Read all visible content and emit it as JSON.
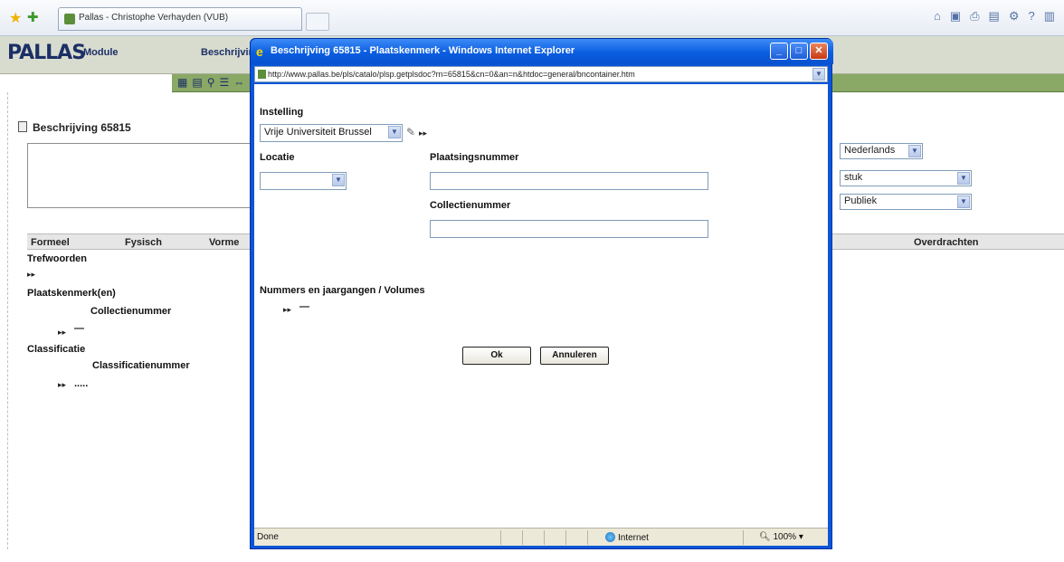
{
  "browser": {
    "tab_title": "Pallas - Christophe Verhayden (VUB)",
    "cmd_icons": [
      "home-icon",
      "feeds-icon",
      "print-icon",
      "page-icon",
      "tools-icon",
      "help-icon"
    ]
  },
  "app": {
    "logo": "PALLAS",
    "menu_module": "Module",
    "menu_beschrijving": "Beschrijving",
    "record_title": "Beschrijving 65815",
    "columns": [
      "Formeel",
      "Fysisch",
      "Vorme"
    ],
    "col_overdrachten": "Overdrachten",
    "tree": {
      "trefwoorden": "Trefwoorden",
      "plaatskenmerken": "Plaatskenmerk(en)",
      "collectienummer": "Collectienummer",
      "dash": "—",
      "classificatie": "Classificatie",
      "classificatienummer": "Classificatienummer",
      "dots": "....."
    },
    "right_selects": {
      "language": "Nederlands",
      "type": "stuk",
      "audience": "Publiek"
    }
  },
  "popup": {
    "title": "Beschrijving 65815 - Plaatskenmerk - Windows Internet Explorer",
    "url": "http://www.pallas.be/pls/catalo/plsp.getplsdoc?rn=65815&cn=0&an=n&htdoc=general/bncontainer.htm",
    "instelling_label": "Instelling",
    "instelling_value": "Vrije Universiteit Brussel",
    "locatie_label": "Locatie",
    "locatie_value": "",
    "plaatsingsnummer_label": "Plaatsingsnummer",
    "plaatsingsnummer_value": "",
    "collectienummer_label": "Collectienummer",
    "collectienummer_value": "",
    "volumes_label": "Nummers en jaargangen / Volumes",
    "volumes_dash": "—",
    "ok_label": "Ok",
    "cancel_label": "Annuleren",
    "status_done": "Done",
    "status_zone": "Internet",
    "status_zoom": "100%"
  }
}
